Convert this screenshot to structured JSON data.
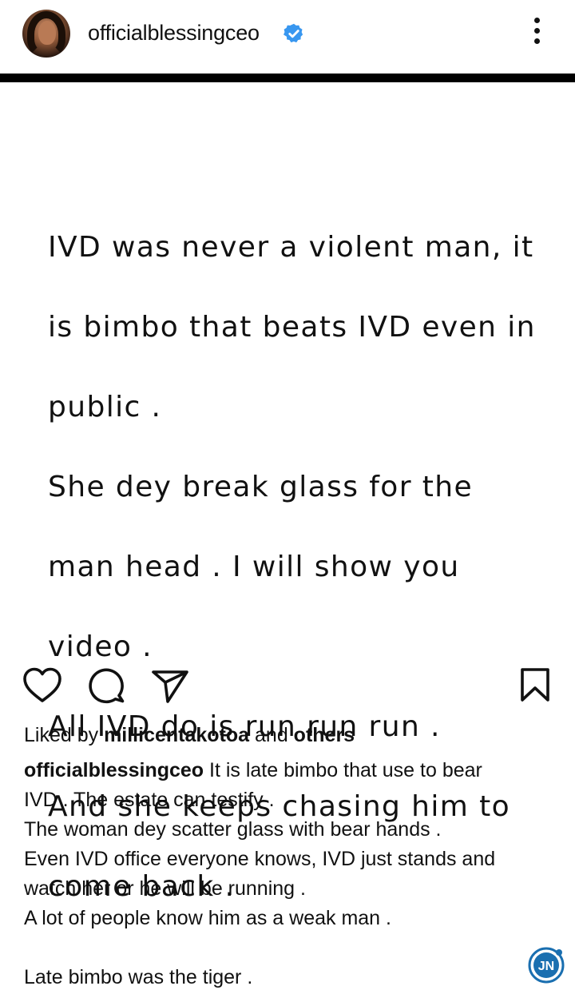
{
  "header": {
    "username": "officialblessingceo",
    "verified": true,
    "verified_color": "#3897f0"
  },
  "post": {
    "image_text_lines": [
      "IVD was never a violent man, it",
      "is bimbo that beats IVD even in",
      "public .",
      "She dey break glass for the",
      "man head . I will show you",
      "video .",
      "All IVD do is run run run .",
      "And she keeps chasing him to",
      "come back ."
    ]
  },
  "actions": {
    "like_icon": "heart-icon",
    "comment_icon": "comment-icon",
    "share_icon": "paper-plane-icon",
    "save_icon": "bookmark-icon"
  },
  "likes": {
    "prefix": "Liked by ",
    "user": "millicentakotoa",
    "middle": " and ",
    "others": "others"
  },
  "caption": {
    "user": "officialblessingceo",
    "first_line_rest": " It is late bimbo that use to bear",
    "lines": [
      "IVD . The estate can testify .",
      "The woman dey scatter glass with bear hands .",
      "Even IVD office everyone knows, IVD just stands and",
      "watch her or he will be running .",
      "A lot of people know him as a weak man ."
    ],
    "last_line": "Late bimbo was the tiger ."
  },
  "watermark": {
    "text": "JN",
    "color": "#1a6fb0"
  }
}
